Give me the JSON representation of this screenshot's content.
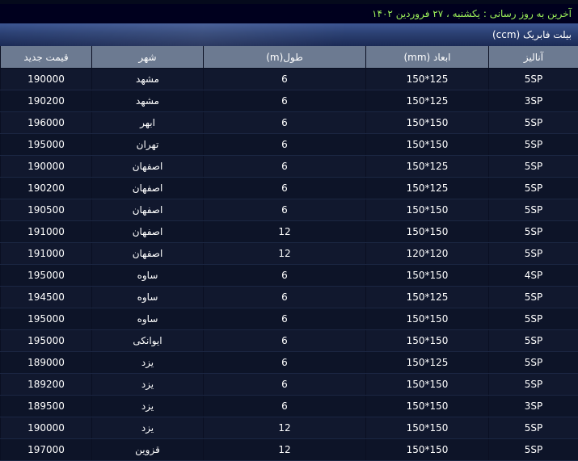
{
  "header": {
    "update_text": "آخرین به روز رسانی : یکشنبه ، ۲۷ فروردین ۱۴۰۲",
    "table_title": "بیلت فابریک (ccm)"
  },
  "table": {
    "columns": [
      "آنالیز",
      "ابعاد (mm)",
      "طول(m)",
      "شهر",
      "قیمت جدید"
    ],
    "rows": [
      [
        "5SP",
        "150*125",
        "6",
        "مشهد",
        "190000"
      ],
      [
        "3SP",
        "150*125",
        "6",
        "مشهد",
        "190200"
      ],
      [
        "5SP",
        "150*150",
        "6",
        "ابهر",
        "196000"
      ],
      [
        "5SP",
        "150*150",
        "6",
        "تهران",
        "195000"
      ],
      [
        "5SP",
        "150*125",
        "6",
        "اصفهان",
        "190000"
      ],
      [
        "5SP",
        "150*125",
        "6",
        "اصفهان",
        "190200"
      ],
      [
        "5SP",
        "150*150",
        "6",
        "اصفهان",
        "190500"
      ],
      [
        "5SP",
        "150*150",
        "12",
        "اصفهان",
        "191000"
      ],
      [
        "5SP",
        "120*120",
        "12",
        "اصفهان",
        "191000"
      ],
      [
        "4SP",
        "150*150",
        "6",
        "ساوه",
        "195000"
      ],
      [
        "5SP",
        "150*125",
        "6",
        "ساوه",
        "194500"
      ],
      [
        "5SP",
        "150*150",
        "6",
        "ساوه",
        "195000"
      ],
      [
        "5SP",
        "150*150",
        "6",
        "ایوانکی",
        "195000"
      ],
      [
        "5SP",
        "150*125",
        "6",
        "یزد",
        "189000"
      ],
      [
        "5SP",
        "150*150",
        "6",
        "یزد",
        "189200"
      ],
      [
        "3SP",
        "150*150",
        "6",
        "یزد",
        "189500"
      ],
      [
        "5SP",
        "150*150",
        "12",
        "یزد",
        "190000"
      ],
      [
        "5SP",
        "150*150",
        "12",
        "قزوین",
        "197000"
      ]
    ]
  },
  "colors": {
    "update_text": "#9cf05a",
    "header_row": "#6c7a91",
    "title_bar": "#2b4072",
    "background": "#0b1430"
  }
}
